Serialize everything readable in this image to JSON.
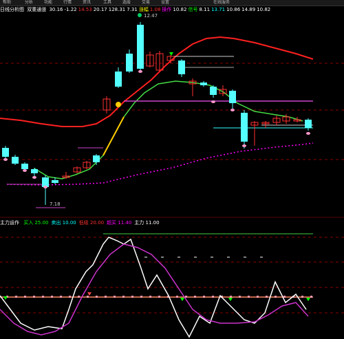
{
  "menu": {
    "items": [
      "帮助",
      "分析",
      "功能",
      "行情",
      "资讯",
      "工具",
      "选股",
      "交易",
      "设置",
      "在线服务"
    ]
  },
  "title_strip": {
    "prefix": "日线分析图",
    "indicator": "双重通道",
    "values": [
      {
        "text": "30.16",
        "color": "#ffffff"
      },
      {
        "text": "-1.22",
        "color": "#ffffff"
      },
      {
        "text": "14.53",
        "color": "#ff3030"
      },
      {
        "text": "20.17",
        "color": "#ffffff"
      },
      {
        "text": "128.31",
        "color": "#ffffff"
      },
      {
        "text": "7.31",
        "color": "#ffffff"
      },
      {
        "text": "涨幅",
        "color": "#ffff00"
      },
      {
        "text": "1.08",
        "color": "#ff3030"
      },
      {
        "text": "操作",
        "color": "#ff00ff"
      },
      {
        "text": "10.82",
        "color": "#ffffff"
      },
      {
        "text": "信号",
        "color": "#00ff00"
      },
      {
        "text": "8.11",
        "color": "#ffffff"
      },
      {
        "text": "13.71",
        "color": "#00ffff"
      },
      {
        "text": "10.86",
        "color": "#ffffff"
      },
      {
        "text": "14.89",
        "color": "#ffffff"
      },
      {
        "text": "10.82",
        "color": "#ffffff"
      }
    ]
  },
  "price_labels": {
    "high": "12.47",
    "low": "7.18"
  },
  "indicator_strip": {
    "name": "主力运作",
    "items": [
      {
        "label": "买入",
        "value": "25.00",
        "color": "#00ff00"
      },
      {
        "label": "卖出",
        "value": "10.00",
        "color": "#00ffff"
      },
      {
        "label": "低吸",
        "value": "20.00",
        "color": "#ff3030"
      },
      {
        "label": "超买",
        "value": "11.40",
        "color": "#ff00ff"
      },
      {
        "label": "主力",
        "value": "11.00",
        "color": "#ffffff"
      }
    ]
  },
  "colors": {
    "background": "#000000",
    "candle_up": "#ff3030",
    "candle_down": "#54ffff",
    "grid": "#8b0000",
    "upper_band": "#ff2020",
    "lower_band": "#ff00ff",
    "ref_line": "#cc44cc",
    "support_line": "#22aaaa"
  }
}
